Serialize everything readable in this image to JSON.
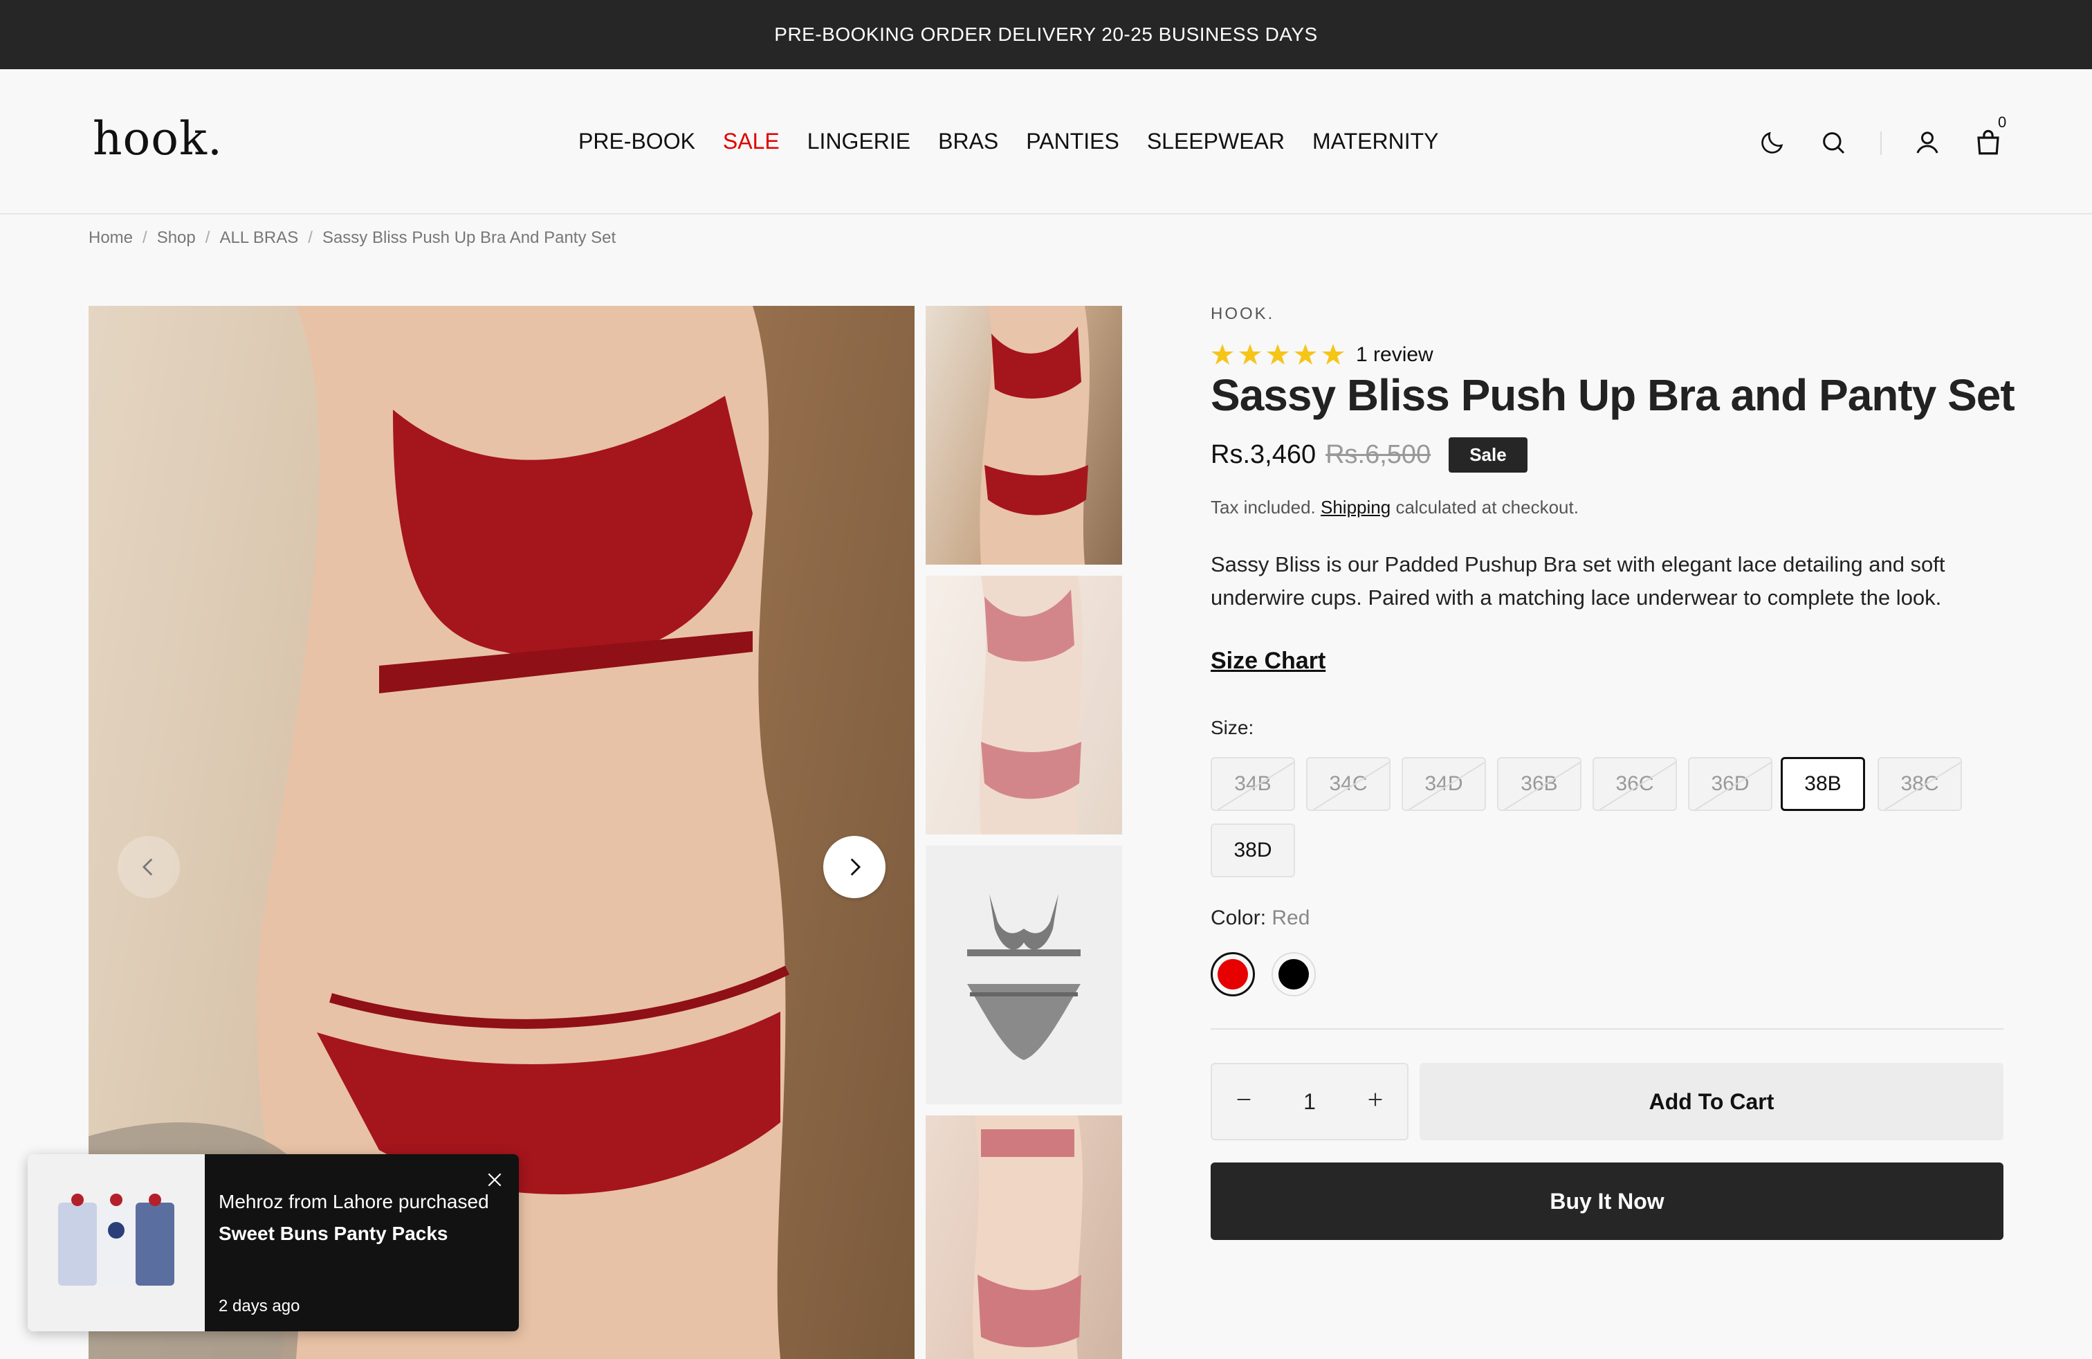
{
  "announcement": "PRE-BOOKING ORDER DELIVERY 20-25 BUSINESS DAYS",
  "logo": "hook.",
  "nav": {
    "prebook": "PRE-BOOK",
    "sale": "SALE",
    "lingerie": "LINGERIE",
    "bras": "BRAS",
    "panties": "PANTIES",
    "sleepwear": "SLEEPWEAR",
    "maternity": "MATERNITY"
  },
  "header_icons": [
    "theme-moon-icon",
    "search-icon",
    "account-icon",
    "cart-icon"
  ],
  "cart_count": "0",
  "breadcrumb": {
    "home": "Home",
    "shop": "Shop",
    "category": "ALL BRAS",
    "current": "Sassy Bliss Push Up Bra And Panty Set",
    "sep": "/"
  },
  "product": {
    "vendor": "HOOK.",
    "rating_stars": 5,
    "review_count": "1 review",
    "title": "Sassy Bliss Push Up Bra and Panty Set",
    "price": "Rs.3,460",
    "compare_price": "Rs.6,500",
    "badge": "Sale",
    "tax_prefix": "Tax included.",
    "tax_link": "Shipping",
    "tax_suffix": "calculated at checkout.",
    "description": "Sassy Bliss is our Padded Pushup Bra set with elegant lace detailing and soft underwire cups. Paired with a matching lace underwear to complete the look.",
    "size_chart": "Size Chart",
    "size_label": "Size:",
    "sizes": [
      "34B",
      "34C",
      "34D",
      "36B",
      "36C",
      "36D",
      "38B",
      "38C",
      "38D"
    ],
    "selected_size": "38B",
    "color_label": "Color:",
    "color_value": "Red",
    "colors": [
      "#e60000",
      "#000000"
    ],
    "quantity": "1",
    "add_to_cart": "Add To Cart",
    "buy_now": "Buy It Now"
  },
  "popup": {
    "line1": "Mehroz from Lahore purchased",
    "line2": "Sweet Buns Panty Packs",
    "time": "2 days ago"
  },
  "accent_colors": {
    "sale": "#e10000",
    "dark": "#262626",
    "star": "#f5c518"
  }
}
